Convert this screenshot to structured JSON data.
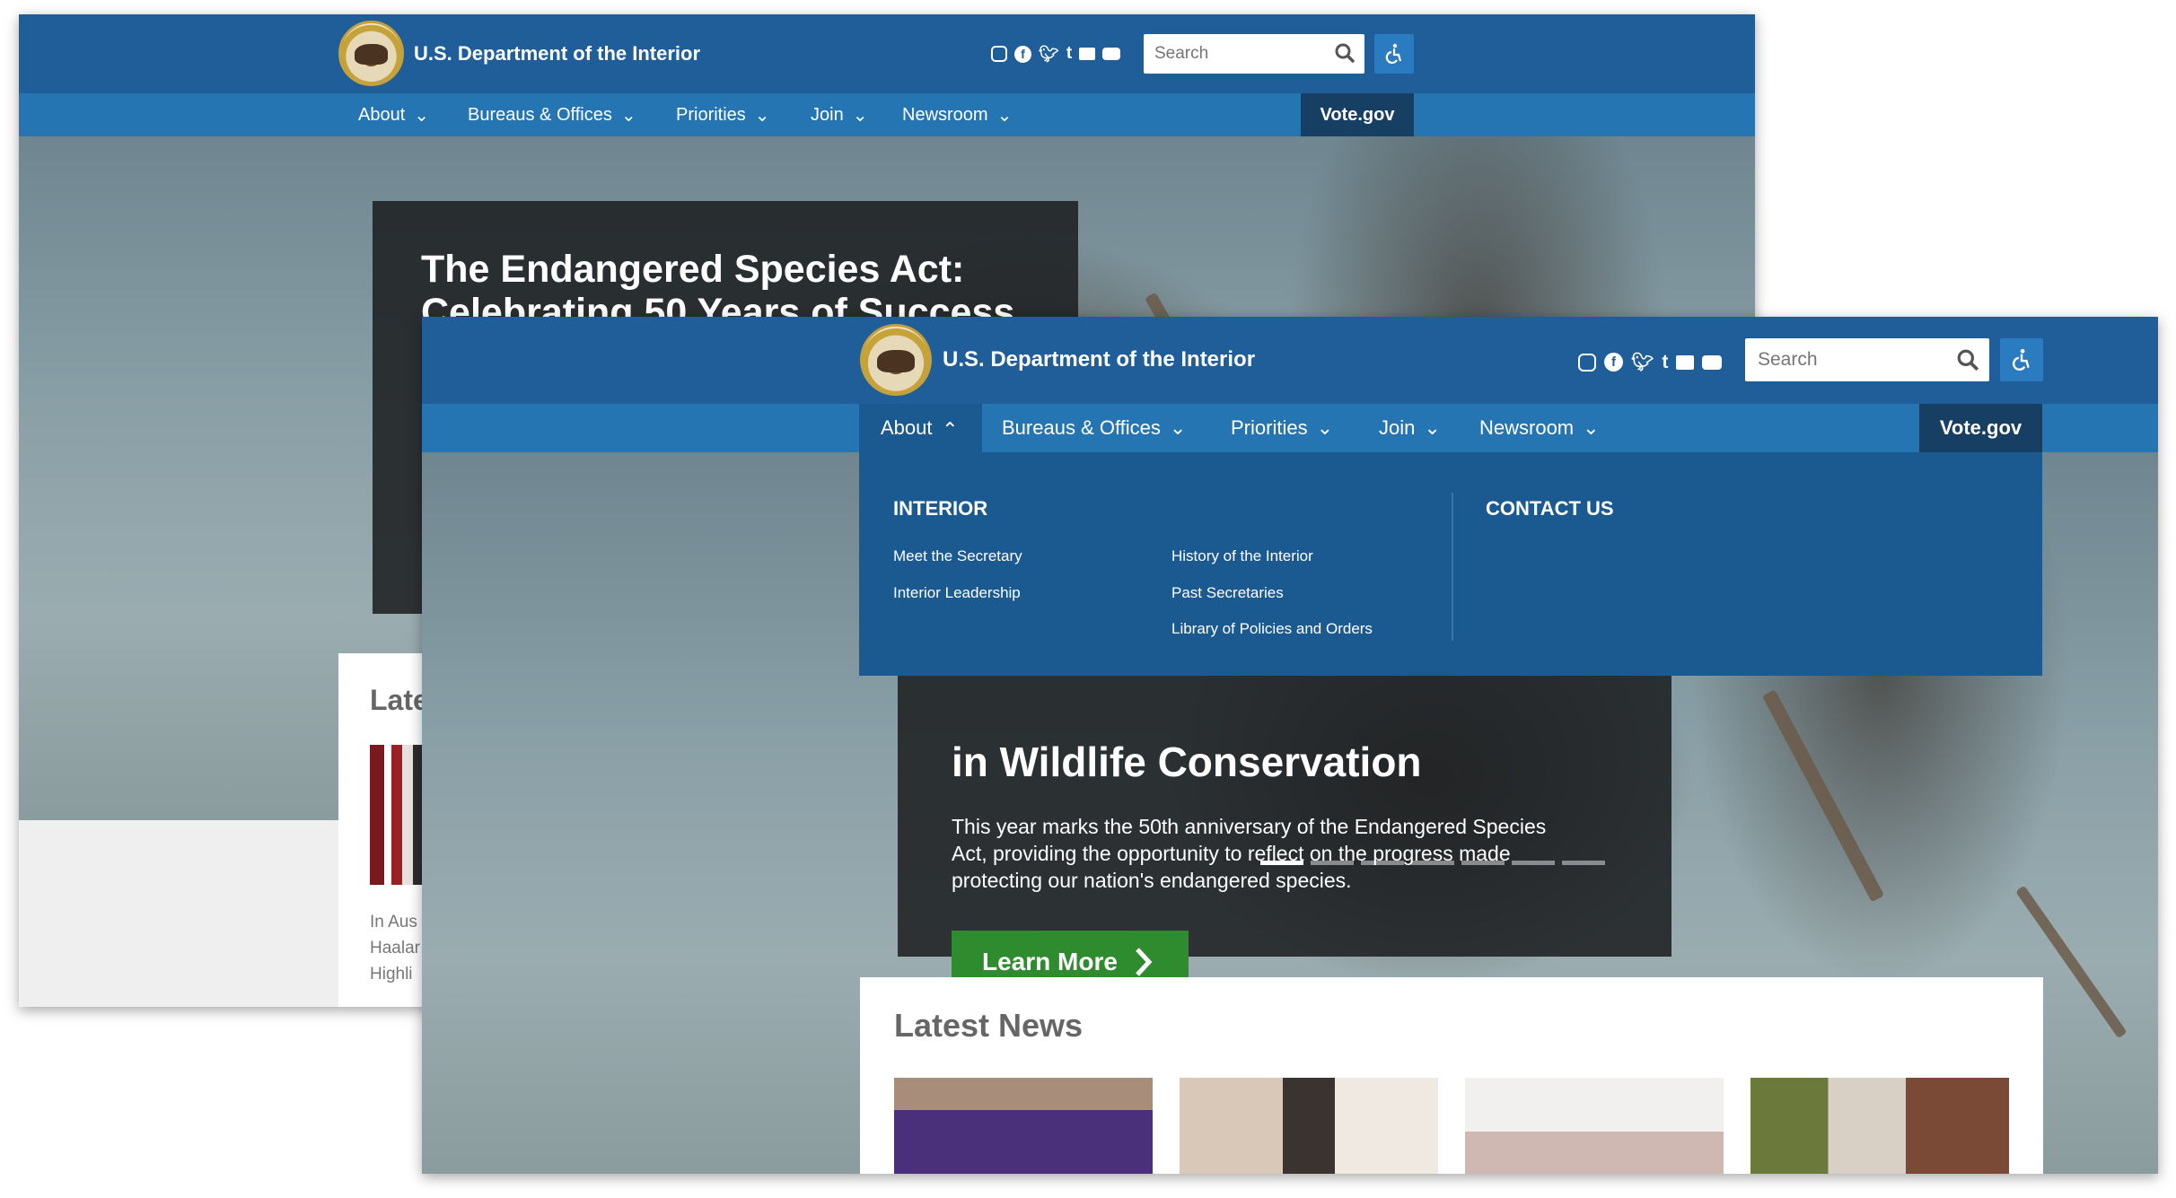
{
  "site": {
    "name": "U.S. Department of the Interior",
    "search_placeholder": "Search",
    "social_icons": [
      "instagram-icon",
      "facebook-icon",
      "twitter-icon",
      "tumblr-icon",
      "flickr-icon",
      "youtube-icon"
    ]
  },
  "nav": {
    "items": [
      {
        "label": "About"
      },
      {
        "label": "Bureaus & Offices"
      },
      {
        "label": "Priorities"
      },
      {
        "label": "Join"
      },
      {
        "label": "Newsroom"
      }
    ],
    "vote": "Vote.gov"
  },
  "hero_back": {
    "title_line1": "The Endangered Species Act:",
    "title_line2": "Celebrating 50 Years of Success"
  },
  "hero_front": {
    "title": "in Wildlife Conservation",
    "body_line1": "This year marks the 50th anniversary of the Endangered Species",
    "body_line2": "Act, providing the opportunity to reflect on the progress made",
    "body_line3": "protecting our nation's endangered species.",
    "button": "Learn More"
  },
  "dropdown": {
    "section1_title": "INTERIOR",
    "col1": [
      "Meet the Secretary",
      "Interior Leadership"
    ],
    "col2": [
      "History of the Interior",
      "Past Secretaries",
      "Library of Policies and Orders"
    ],
    "section2_title": "CONTACT US"
  },
  "news": {
    "title": "Latest News",
    "back_title_fragment": "Late",
    "back_text": [
      "In Aus",
      "Haalar",
      "Highli"
    ]
  },
  "carousel": {
    "count": 7,
    "active": 0
  },
  "colors": {
    "header": "#1f5e98",
    "nav": "#2575b3",
    "vote": "#173f63",
    "dropdown": "#1b5a90",
    "cta": "#2e8b2e"
  }
}
